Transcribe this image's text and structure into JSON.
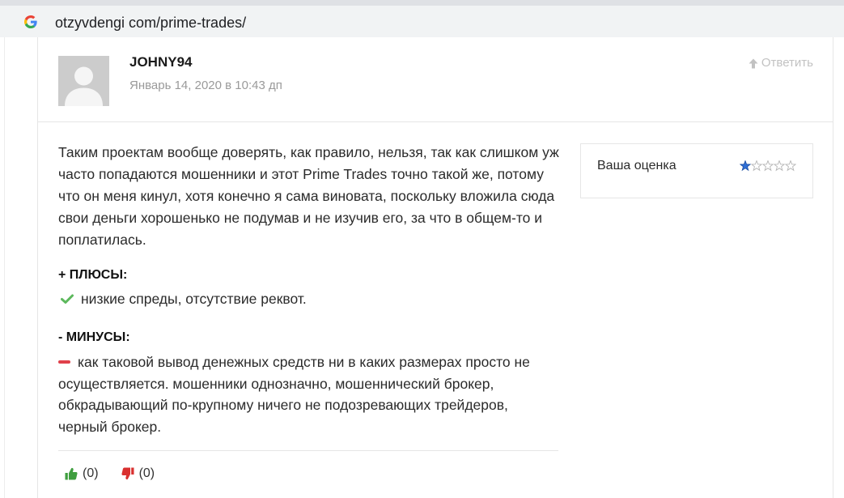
{
  "browser": {
    "url": "otzyvdengi com/prime-trades/",
    "site_icon": "google-g-icon"
  },
  "comment": {
    "author": "JOHNY94",
    "date": "Январь 14, 2020 в 10:43 дп",
    "avatar_icon": "default-avatar-icon",
    "reply": {
      "label": "Ответить",
      "icon": "arrow-up-icon"
    },
    "text_lines": [
      "Таким проектам вообще доверять, как правило, нельзя, так как слишком уж",
      "часто попадаются мошенники и этот Prime Trades точно такой же, потому",
      "что он меня кинул, хотя конечно я сама виновата, поскольку вложила сюда",
      "свои деньги хорошенько не подумав и не изучив его, за что в общем-то и",
      "поплатилась."
    ],
    "pros": {
      "heading": "+ ПЛЮСЫ:",
      "icon": "check-icon",
      "text": "низкие спреды, отсутствие реквот."
    },
    "cons": {
      "heading": "- МИНУСЫ:",
      "icon": "minus-icon",
      "text_lines": [
        "как таковой вывод денежных средств ни в каких размерах просто не",
        "осуществляется. мошенники однозначно, мошеннический брокер,",
        "обкрадывающий по-крупному ничего не подозревающих трейдеров,",
        "черный брокер."
      ]
    },
    "rating": {
      "label": "Ваша оценка",
      "value": 1,
      "max": 5,
      "star_icon": "star-icon"
    },
    "votes": {
      "like": {
        "icon": "thumbs-up-icon",
        "count": "(0)"
      },
      "dislike": {
        "icon": "thumbs-down-icon",
        "count": "(0)"
      }
    }
  },
  "colors": {
    "text": "#2b2b2b",
    "muted": "#9a9a9a",
    "reply": "#c2c2c2",
    "url": "#202124",
    "chrome_bg": "#f1f3f4",
    "tabstrip_bg": "#dfe1e5",
    "border": "#e6e6e6",
    "avatar_bg": "#cccccc",
    "star_filled": "#2f6fd6",
    "star_filled_stroke": "#1d4fa3",
    "star_empty": "#b5b5b5",
    "pros": "#5cb85c",
    "cons": "#e0404a",
    "like": "#3f9e3f",
    "dislike": "#d9302f"
  }
}
